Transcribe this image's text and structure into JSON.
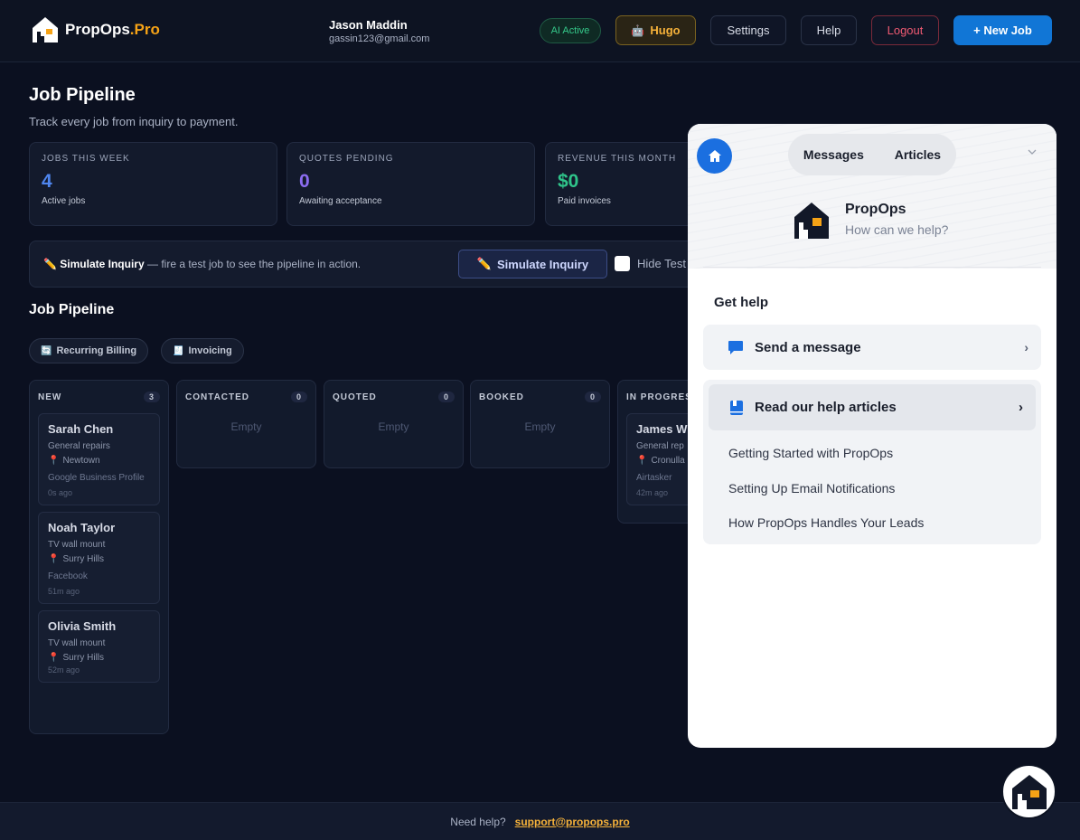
{
  "header": {
    "logo_main": "PropOps",
    "logo_suffix": ".Pro",
    "user_name": "Jason Maddin",
    "user_email": "gassin123@gmail.com",
    "ai_status": "AI Active",
    "hugo_label": "Hugo",
    "settings_label": "Settings",
    "help_label": "Help",
    "logout_label": "Logout",
    "new_job_label": "+ New Job",
    "colors": {
      "accent": "#1176d6",
      "brand": "#f6a316",
      "logout": "#ef5a72",
      "ai": "#35c98a"
    }
  },
  "page": {
    "title": "Job Pipeline",
    "subtitle": "Track every job from inquiry to payment."
  },
  "stats": [
    {
      "label": "JOBS THIS WEEK",
      "value": "4",
      "desc": "Active jobs",
      "color": "#4f86ef"
    },
    {
      "label": "QUOTES PENDING",
      "value": "0",
      "desc": "Awaiting acceptance",
      "color": "#8b6cf0"
    },
    {
      "label": "REVENUE THIS MONTH",
      "value": "$0",
      "desc": "Paid invoices",
      "color": "#2fc48a"
    }
  ],
  "simulate": {
    "bold": "Simulate Inquiry",
    "text": " — fire a test job to see the pipeline in action.",
    "button": "Simulate Inquiry",
    "hide_test": "Hide Test"
  },
  "pipeline": {
    "title": "Job Pipeline",
    "chips": [
      "Recurring Billing",
      "Invoicing"
    ],
    "empty_label": "Empty",
    "columns": [
      {
        "title": "NEW",
        "count": "3"
      },
      {
        "title": "CONTACTED",
        "count": "0"
      },
      {
        "title": "QUOTED",
        "count": "0"
      },
      {
        "title": "BOOKED",
        "count": "0"
      },
      {
        "title": "IN PROGRESS",
        "count": ""
      }
    ],
    "new_cards": [
      {
        "name": "Sarah Chen",
        "service": "General repairs",
        "location": "Newtown",
        "source": "Google Business Profile",
        "time": "0s ago"
      },
      {
        "name": "Noah Taylor",
        "service": "TV wall mount",
        "location": "Surry Hills",
        "source": "Facebook",
        "time": "51m ago"
      },
      {
        "name": "Olivia Smith",
        "service": "TV wall mount",
        "location": "Surry Hills",
        "source": "",
        "time": "52m ago"
      }
    ],
    "in_progress_cards": [
      {
        "name": "James W",
        "service": "General rep",
        "location": "Cronulla",
        "source": "Airtasker",
        "time": "42m ago"
      }
    ]
  },
  "footer": {
    "text": "Need help?",
    "link": "support@propops.pro"
  },
  "widget": {
    "tabs": [
      "Messages",
      "Articles"
    ],
    "brand_name": "PropOps",
    "brand_question": "How can we help?",
    "get_help": "Get help",
    "send_message": "Send a message",
    "read_articles": "Read our help articles",
    "articles": [
      "Getting Started with PropOps",
      "Setting Up Email Notifications",
      "How PropOps Handles Your Leads"
    ]
  }
}
